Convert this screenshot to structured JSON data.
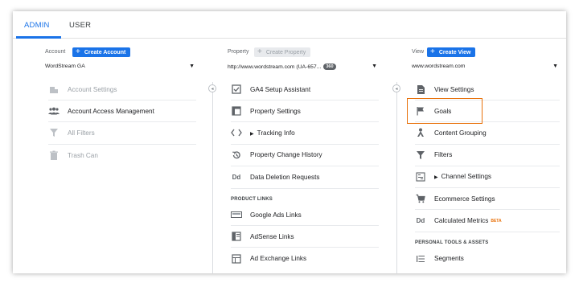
{
  "tabs": [
    {
      "label": "ADMIN",
      "active": true
    },
    {
      "label": "USER",
      "active": false
    }
  ],
  "account": {
    "label": "Account",
    "create_button": "Create Account",
    "selected": "WordStream GA",
    "items": [
      {
        "label": "Account Settings",
        "icon": "building-icon",
        "enabled": false
      },
      {
        "label": "Account Access Management",
        "icon": "people-icon",
        "enabled": true
      },
      {
        "label": "All Filters",
        "icon": "filter-icon",
        "enabled": false
      },
      {
        "label": "Trash Can",
        "icon": "trash-icon",
        "enabled": false
      }
    ]
  },
  "property": {
    "label": "Property",
    "create_button": "Create Property",
    "selected": "http://www.wordstream.com (UA-657...",
    "badge": "360",
    "items": [
      {
        "label": "GA4 Setup Assistant",
        "icon": "checkbox-icon"
      },
      {
        "label": "Property Settings",
        "icon": "settings-window-icon"
      },
      {
        "label": "Tracking Info",
        "icon": "code-icon",
        "expandable": true
      },
      {
        "label": "Property Change History",
        "icon": "history-icon"
      },
      {
        "label": "Data Deletion Requests",
        "icon": "dd-icon"
      }
    ],
    "section": "PRODUCT LINKS",
    "links": [
      {
        "label": "Google Ads Links",
        "icon": "ads-icon"
      },
      {
        "label": "AdSense Links",
        "icon": "adsense-icon"
      },
      {
        "label": "Ad Exchange Links",
        "icon": "adexchange-icon"
      }
    ]
  },
  "view": {
    "label": "View",
    "create_button": "Create View",
    "selected": "www.wordstream.com",
    "items": [
      {
        "label": "View Settings",
        "icon": "document-icon"
      },
      {
        "label": "Goals",
        "icon": "flag-icon",
        "highlighted": true
      },
      {
        "label": "Content Grouping",
        "icon": "grouping-icon"
      },
      {
        "label": "Filters",
        "icon": "filter-icon"
      },
      {
        "label": "Channel Settings",
        "icon": "channel-icon",
        "expandable": true
      },
      {
        "label": "Ecommerce Settings",
        "icon": "cart-icon"
      },
      {
        "label": "Calculated Metrics",
        "icon": "dd-icon",
        "beta": "BETA"
      }
    ],
    "section": "PERSONAL TOOLS & ASSETS",
    "tools": [
      {
        "label": "Segments",
        "icon": "segments-icon"
      }
    ]
  },
  "colors": {
    "accent": "#1a73e8",
    "highlight": "#e8710a",
    "dim": "#9aa0a6"
  }
}
